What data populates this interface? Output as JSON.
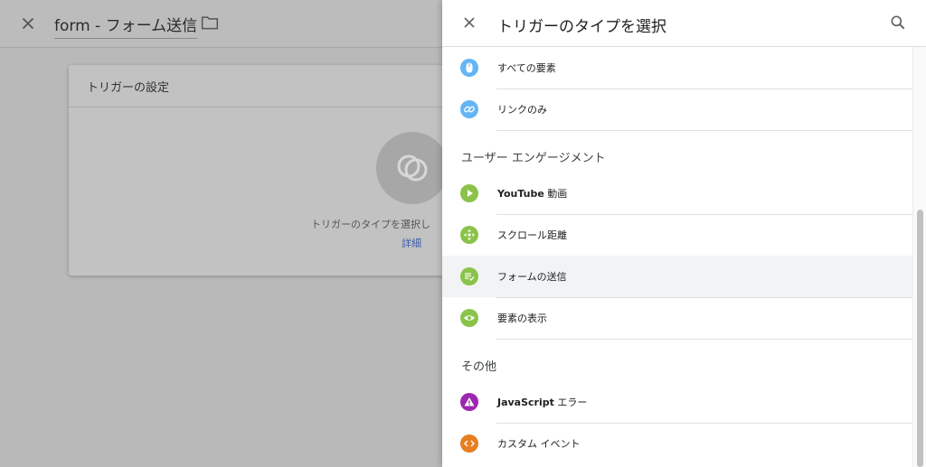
{
  "background": {
    "title": "form - フォーム送信",
    "card_title": "トリガーの設定",
    "card_hint": "トリガーのタイプを選択し",
    "card_link": "詳細"
  },
  "panel": {
    "title": "トリガーのタイプを選択",
    "items_top": [
      {
        "label": "すべての要素",
        "icon": "mouse-icon",
        "color": "#64b5f6"
      },
      {
        "label": "リンクのみ",
        "icon": "link-icon",
        "color": "#64b5f6"
      }
    ],
    "section_engagement": "ユーザー エンゲージメント",
    "items_engagement": [
      {
        "label_bold": "YouTube",
        "label_rest": " 動画",
        "icon": "play-icon",
        "color": "#8bc34a"
      },
      {
        "label": "スクロール距離",
        "icon": "scroll-icon",
        "color": "#8bc34a"
      },
      {
        "label": "フォームの送信",
        "icon": "form-icon",
        "color": "#8bc34a",
        "selected": true
      },
      {
        "label": "要素の表示",
        "icon": "eye-icon",
        "color": "#8bc34a"
      }
    ],
    "section_other": "その他",
    "items_other": [
      {
        "label_bold": "JavaScript",
        "label_rest": " エラー",
        "icon": "warning-icon",
        "color": "#9c27b0"
      },
      {
        "label": "カスタム イベント",
        "icon": "code-icon",
        "color": "#e67e22"
      }
    ]
  }
}
